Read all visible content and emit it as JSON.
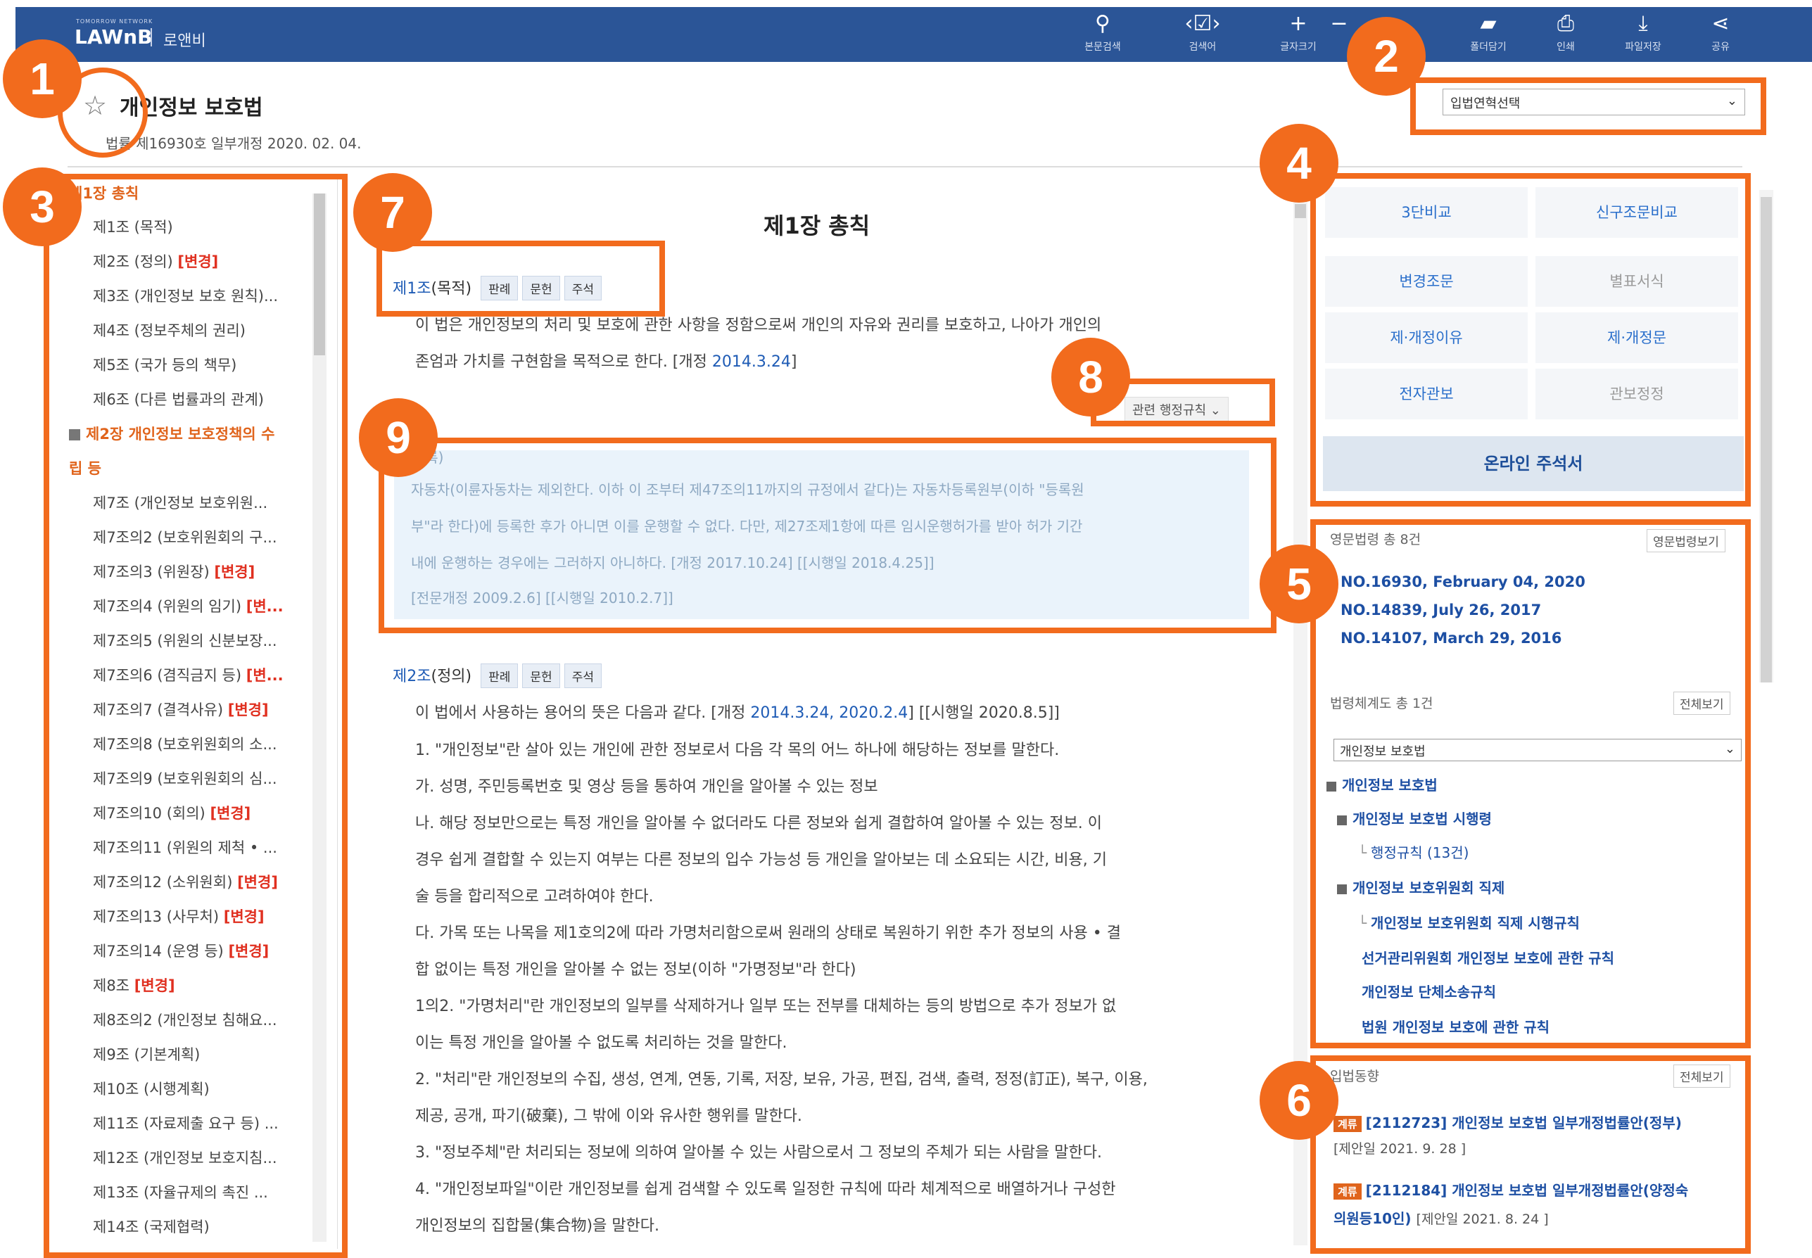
{
  "app": {
    "brand_small": "TOMORROW NETWORK",
    "brand": "LAWnB",
    "brand_sub": "로앤비"
  },
  "toolbar": [
    {
      "icon": "search-icon",
      "glyph": "⚲",
      "label": "본문검색"
    },
    {
      "icon": "checkbox-nav-icon",
      "glyph": "‹☑›",
      "label": "검색어"
    },
    {
      "icon": "zoom-in-icon",
      "glyph": "+",
      "label": "글자크기"
    },
    {
      "icon": "zoom-out-icon",
      "glyph": "−",
      "label": ""
    },
    {
      "icon": "folder-icon",
      "glyph": "▰",
      "label": "폴더담기"
    },
    {
      "icon": "print-icon",
      "glyph": "⎙",
      "label": "인쇄"
    },
    {
      "icon": "download-icon",
      "glyph": "⤓",
      "label": "파일저장"
    },
    {
      "icon": "share-icon",
      "glyph": "⋖",
      "label": "공유"
    }
  ],
  "header": {
    "law_title": "개인정보 보호법",
    "law_meta": "법률 제16930호 일부개정 2020. 02. 04.",
    "history_select": "입법연혁선택"
  },
  "toc": {
    "chapter1": "제1장 총칙",
    "items_a": [
      {
        "label": "제1조 (목적)",
        "chg": ""
      },
      {
        "label": "제2조 (정의)",
        "chg": "[변경]"
      },
      {
        "label": "제3조 (개인정보 보호 원칙)...",
        "chg": ""
      },
      {
        "label": "제4조 (정보주체의 권리)",
        "chg": ""
      },
      {
        "label": "제5조 (국가 등의 책무)",
        "chg": ""
      },
      {
        "label": "제6조 (다른 법률과의 관계)",
        "chg": ""
      }
    ],
    "chapter2_l1": "제2장 개인정보 보호정책의 수",
    "chapter2_l2": "립 등",
    "items_b": [
      {
        "label": "제7조 (개인정보 보호위원...",
        "chg": ""
      },
      {
        "label": "제7조의2 (보호위원회의 구...",
        "chg": ""
      },
      {
        "label": "제7조의3 (위원장)",
        "chg": "[변경]"
      },
      {
        "label": "제7조의4 (위원의 임기)",
        "chg": "[변..."
      },
      {
        "label": "제7조의5 (위원의 신분보장...",
        "chg": ""
      },
      {
        "label": "제7조의6 (겸직금지 등)",
        "chg": "[변..."
      },
      {
        "label": "제7조의7 (결격사유)",
        "chg": "[변경]"
      },
      {
        "label": "제7조의8 (보호위원회의 소...",
        "chg": ""
      },
      {
        "label": "제7조의9 (보호위원회의 심...",
        "chg": ""
      },
      {
        "label": "제7조의10 (회의)",
        "chg": "[변경]"
      },
      {
        "label": "제7조의11 (위원의 제척 • ...",
        "chg": ""
      },
      {
        "label": "제7조의12 (소위원회)",
        "chg": "[변경]"
      },
      {
        "label": "제7조의13 (사무처)",
        "chg": "[변경]"
      },
      {
        "label": "제7조의14 (운영 등)",
        "chg": "[변경]"
      },
      {
        "label": "제8조",
        "chg": "[변경]"
      },
      {
        "label": "제8조의2 (개인정보 침해요...",
        "chg": ""
      },
      {
        "label": "제9조 (기본계획)",
        "chg": ""
      },
      {
        "label": "제10조 (시행계획)",
        "chg": ""
      },
      {
        "label": "제11조 (자료제출 요구 등) ...",
        "chg": ""
      },
      {
        "label": "제12조 (개인정보 보호지침...",
        "chg": ""
      },
      {
        "label": "제13조 (자율규제의 촉진 ...",
        "chg": ""
      },
      {
        "label": "제14조 (국제협력)",
        "chg": ""
      }
    ]
  },
  "main": {
    "chapter_title": "제1장 총칙",
    "art1": {
      "num": "제1조",
      "name": "(목적)"
    },
    "tags": [
      "판례",
      "문헌",
      "주석"
    ],
    "art1_p1": "이 법은 개인정보의 처리 및 보호에 관한 사항을 정함으로써 개인의 자유와 권리를 보호하고, 나아가 개인의",
    "art1_p2a": "존엄과 가치를 구현함을 목적으로 한다. [개정",
    "art1_p2link": "2014.3.24",
    "art1_p2b": "]",
    "related": "관련 행정규칙 ⌄",
    "faded_head": "(등록)",
    "faded_1": "자동차(이륜자동차는 제외한다. 이하 이 조부터 제47조의11까지의 규정에서 같다)는 자동차등록원부(이하 \"등록원",
    "faded_2": "부\"라 한다)에 등록한 후가 아니면 이를 운행할 수 없다. 다만, 제27조제1항에 따른 임시운행허가를 받아 허가 기간",
    "faded_3": "내에 운행하는 경우에는 그러하지 아니하다. [개정 2017.10.24] [[시행일 2018.4.25]]",
    "faded_4": "[전문개정 2009.2.6] [[시행일 2010.2.7]]",
    "art2": {
      "num": "제2조",
      "name": "(정의)"
    },
    "art2_p0a": "이 법에서 사용하는 용어의 뜻은 다음과 같다. [개정",
    "art2_p0link": "2014.3.24, 2020.2.4",
    "art2_p0b": "] [[시행일 2020.8.5]]",
    "lines": [
      "1. \"개인정보\"란 살아 있는 개인에 관한 정보로서 다음 각 목의 어느 하나에 해당하는 정보를 말한다.",
      "가. 성명, 주민등록번호 및 영상 등을 통하여 개인을 알아볼 수 있는 정보",
      "나. 해당 정보만으로는 특정 개인을 알아볼 수 없더라도 다른 정보와 쉽게 결합하여 알아볼 수 있는 정보. 이",
      "경우 쉽게 결합할 수 있는지 여부는 다른 정보의 입수 가능성 등 개인을 알아보는 데 소요되는 시간, 비용, 기",
      "술 등을 합리적으로 고려하여야 한다.",
      "다. 가목 또는 나목을 제1호의2에 따라 가명처리함으로써 원래의 상태로 복원하기 위한 추가 정보의 사용 • 결",
      "합 없이는 특정 개인을 알아볼 수 없는 정보(이하 \"가명정보\"라 한다)",
      "1의2. \"가명처리\"란 개인정보의 일부를 삭제하거나 일부 또는 전부를 대체하는 등의 방법으로 추가 정보가 없",
      "이는 특정 개인을 알아볼 수 없도록 처리하는 것을 말한다.",
      "2. \"처리\"란 개인정보의 수집, 생성, 연계, 연동, 기록, 저장, 보유, 가공, 편집, 검색, 출력, 정정(訂正), 복구, 이용,",
      "제공, 공개, 파기(破棄), 그 밖에 이와 유사한 행위를 말한다.",
      "3. \"정보주체\"란 처리되는 정보에 의하여 알아볼 수 있는 사람으로서 그 정보의 주체가 되는 사람을 말한다.",
      "4. \"개인정보파일\"이란 개인정보를 쉽게 검색할 수 있도록 일정한 규칙에 따라 체계적으로 배열하거나 구성한",
      "개인정보의 집합물(集合物)을 말한다."
    ]
  },
  "right": {
    "grid": [
      {
        "label": "3단비교",
        "state": "on"
      },
      {
        "label": "신구조문비교",
        "state": "on"
      },
      {
        "label": "변경조문",
        "state": "on"
      },
      {
        "label": "별표서식",
        "state": "off"
      },
      {
        "label": "제·개정이유",
        "state": "on"
      },
      {
        "label": "제·개정문",
        "state": "on"
      },
      {
        "label": "전자관보",
        "state": "on"
      },
      {
        "label": "관보정정",
        "state": "off"
      }
    ],
    "online": "온라인 주석서",
    "eng_label": "영문법령 총 8건",
    "eng_more": "영문법령보기",
    "eng_links": [
      "NO.16930, February 04, 2020",
      "NO.14839, July 26, 2017",
      "NO.14107, March 29, 2016"
    ],
    "sys_label": "법령체계도 총 1건",
    "sys_more": "전체보기",
    "sys_select": "개인정보 보호법",
    "tree": [
      "개인정보 보호법",
      "개인정보 보호법 시행령",
      "행정규칙 (13건)",
      "개인정보 보호위원회 직제",
      "개인정보 보호위원회 직제 시행규칙",
      "선거관리위원회 개인정보 보호에 관한 규칙",
      "개인정보 단체소송규칙",
      "법원 개인정보 보호에 관한 규칙"
    ],
    "bill_label": "입법동향",
    "bill_more": "전체보기",
    "bills": [
      {
        "badge": "계류",
        "title": "[2112723] 개인정보 보호법 일부개정법률안(정부)",
        "date": "[제안일 2021. 9. 28 ]"
      },
      {
        "badge": "계류",
        "title": "[2112184] 개인정보 보호법 일부개정법률안(양정숙",
        "title2": "의원등10인)",
        "date": "[제안일 2021. 8. 24 ]"
      }
    ]
  },
  "annotations": [
    "1",
    "2",
    "3",
    "4",
    "5",
    "6",
    "7",
    "8",
    "9"
  ],
  "colors": {
    "topbar": "#2b5597",
    "annotation": "#f26b1d",
    "link": "#1e5bb5",
    "changed": "#e03020"
  }
}
